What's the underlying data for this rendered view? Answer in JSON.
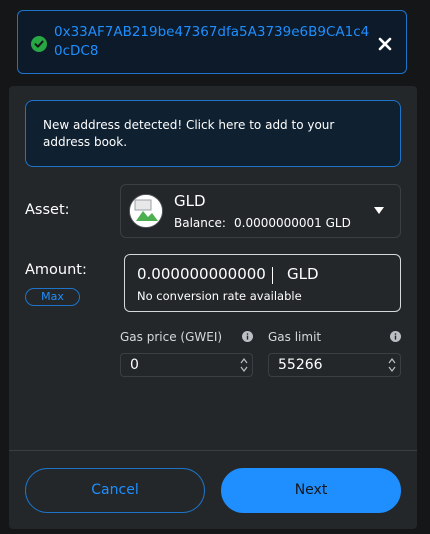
{
  "address_bar": {
    "address": "0x33AF7AB219be47367dfa5A3739e6B9CA1c40cDC8",
    "status_icon": "check-circle-icon",
    "close_icon": "close-icon"
  },
  "notice": {
    "text": "New address detected! Click here to add to your address book."
  },
  "asset": {
    "label": "Asset:",
    "name": "GLD",
    "balance_label": "Balance:",
    "balance_value": "0.0000000001 GLD",
    "icon": "token-image-icon"
  },
  "amount": {
    "label": "Amount:",
    "max_label": "Max",
    "value": "0.000000000000",
    "unit": "GLD",
    "conversion_note": "No conversion rate available"
  },
  "gas": {
    "price_label": "Gas price (GWEI)",
    "price_value": "0",
    "limit_label": "Gas limit",
    "limit_value": "55266"
  },
  "footer": {
    "cancel_label": "Cancel",
    "next_label": "Next"
  },
  "colors": {
    "accent": "#1f8fff",
    "background": "#141618",
    "panel": "#24272a",
    "success": "#28a745"
  }
}
